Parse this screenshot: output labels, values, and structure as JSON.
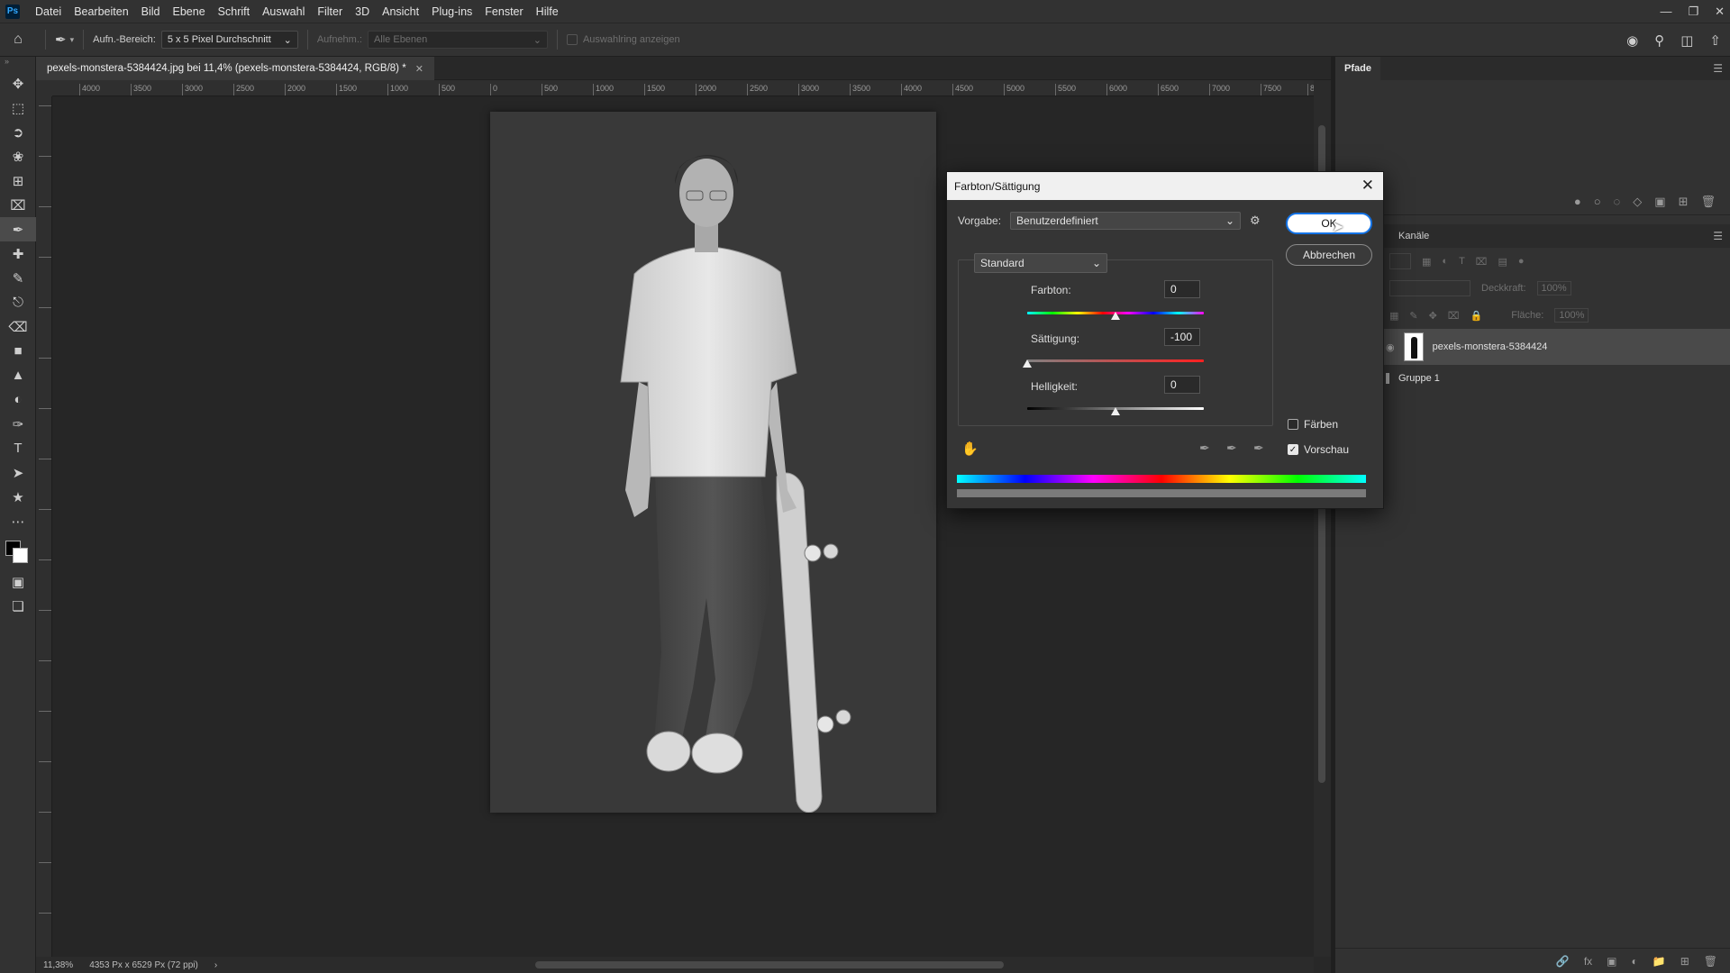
{
  "menubar": {
    "logo": "Ps",
    "items": [
      "Datei",
      "Bearbeiten",
      "Bild",
      "Ebene",
      "Schrift",
      "Auswahl",
      "Filter",
      "3D",
      "Ansicht",
      "Plug-ins",
      "Fenster",
      "Hilfe"
    ]
  },
  "options": {
    "sample_size_label": "Aufn.-Bereich:",
    "sample_size_value": "5 x 5 Pixel Durchschnitt",
    "sample_label": "Aufnehm.:",
    "sample_value": "Alle Ebenen",
    "show_ring": "Auswahlring anzeigen"
  },
  "document": {
    "tab_title": "pexels-monstera-5384424.jpg bei 11,4% (pexels-monstera-5384424, RGB/8) *"
  },
  "ruler": {
    "h_ticks": [
      "4000",
      "3500",
      "3000",
      "2500",
      "2000",
      "1500",
      "1000",
      "500",
      "0",
      "500",
      "1000",
      "1500",
      "2000",
      "2500",
      "3000",
      "3500",
      "4000",
      "4500",
      "5000",
      "5500",
      "6000",
      "6500",
      "7000",
      "7500",
      "8"
    ]
  },
  "status": {
    "zoom": "11,38%",
    "doc_size": "4353 Px x 6529 Px (72 ppi)"
  },
  "panels": {
    "paths_tab": "Pfade",
    "channels_tab": "Kanäle",
    "opacity_label": "Deckkraft:",
    "opacity_value": "100%",
    "fill_label": "Fläche:",
    "fill_value": "100%",
    "layers": [
      {
        "name": "pexels-monstera-5384424",
        "selected": true
      },
      {
        "name": "Gruppe 1",
        "selected": false
      }
    ]
  },
  "dialog": {
    "title": "Farbton/Sättigung",
    "preset_label": "Vorgabe:",
    "preset_value": "Benutzerdefiniert",
    "ok_label": "OK",
    "cancel_label": "Abbrechen",
    "channel_value": "Standard",
    "hue_label": "Farbton:",
    "hue_value": "0",
    "saturation_label": "Sättigung:",
    "saturation_value": "-100",
    "lightness_label": "Helligkeit:",
    "lightness_value": "0",
    "colorize_label": "Färben",
    "colorize_checked": false,
    "preview_label": "Vorschau",
    "preview_checked": true
  }
}
